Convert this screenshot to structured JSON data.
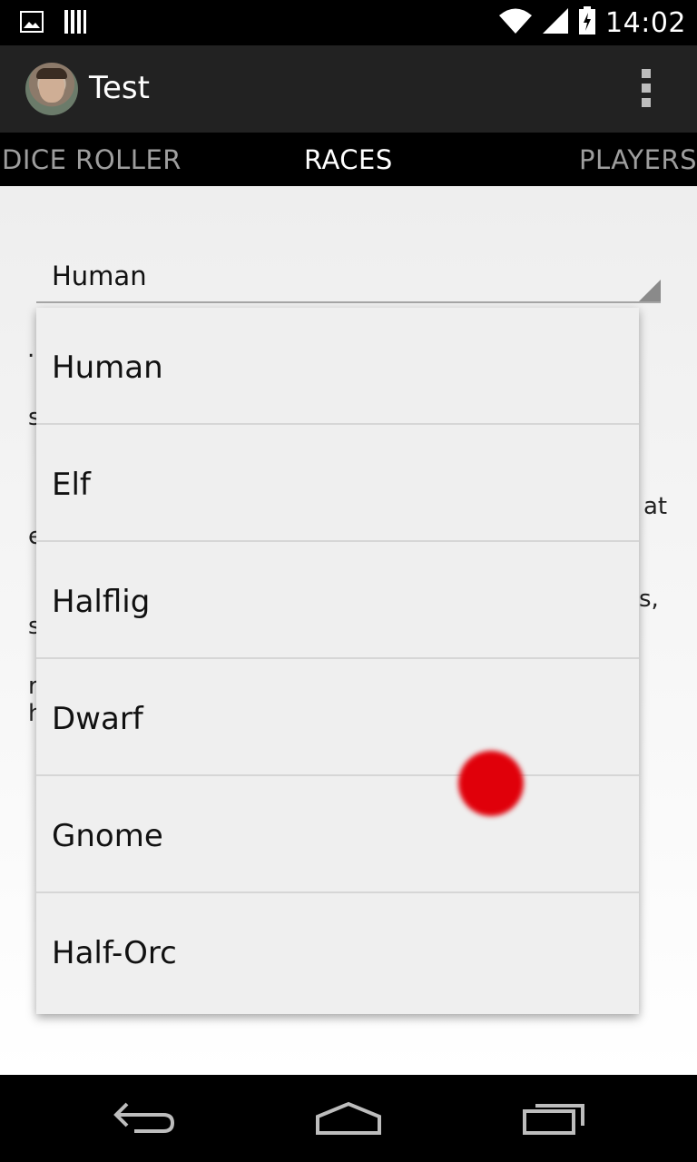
{
  "status_bar": {
    "time": "14:02",
    "icons": [
      "image-notification-icon",
      "storage-notification-icon",
      "wifi-icon",
      "signal-icon",
      "battery-charging-icon"
    ]
  },
  "action_bar": {
    "title": "Test",
    "avatar": "user-avatar",
    "overflow_icon": "overflow-menu-icon"
  },
  "tabs": [
    {
      "label": "DICE ROLLER",
      "selected": false
    },
    {
      "label": "RACES",
      "selected": true
    },
    {
      "label": "PLAYERS",
      "selected": false
    }
  ],
  "spinner": {
    "selected_value": "Human"
  },
  "background_fragments": [
    ".",
    "s",
    "at",
    "e",
    "s,",
    "s",
    "r",
    "h"
  ],
  "dropdown": {
    "options": [
      "Human",
      "Elf",
      "Halflig",
      "Dwarf",
      "Gnome",
      "Half-Orc"
    ]
  },
  "colors": {
    "touch_indicator": "#e0000a",
    "action_bar_bg": "#222222",
    "tab_selected": "#ffffff",
    "tab_unselected": "#9e9e9e"
  },
  "nav_bar": {
    "icons": [
      "back-icon",
      "home-icon",
      "recents-icon"
    ]
  }
}
